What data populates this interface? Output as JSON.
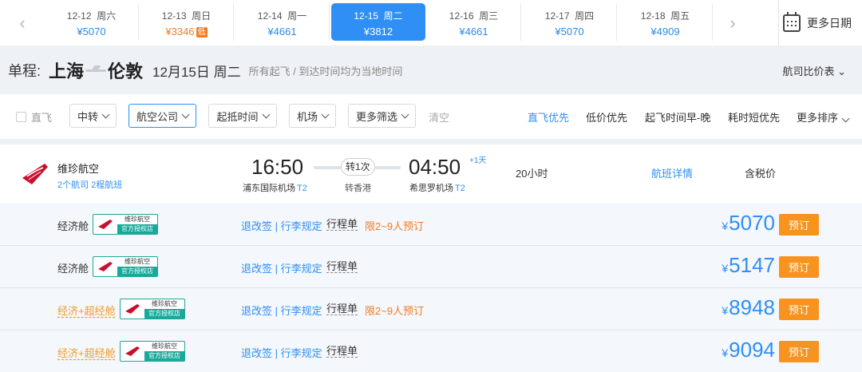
{
  "date_bar": {
    "dates": [
      {
        "date": "12-12",
        "weekday": "周六",
        "price": "¥5070"
      },
      {
        "date": "12-13",
        "weekday": "周日",
        "price": "¥3346",
        "badge": "低"
      },
      {
        "date": "12-14",
        "weekday": "周一",
        "price": "¥4661"
      },
      {
        "date": "12-15",
        "weekday": "周二",
        "price": "¥3812"
      },
      {
        "date": "12-16",
        "weekday": "周三",
        "price": "¥4661"
      },
      {
        "date": "12-17",
        "weekday": "周四",
        "price": "¥5070"
      },
      {
        "date": "12-18",
        "weekday": "周五",
        "price": "¥4909"
      }
    ],
    "prev_icon": "‹",
    "next_icon": "›",
    "more_label": "更多日期"
  },
  "route": {
    "trip_label": "单程:",
    "from": "上海",
    "to": "伦敦",
    "date": "12月15日 周二",
    "note": "所有起飞 / 到达时间均为当地时间",
    "compare_label": "航司比价表",
    "compare_icon": "⌄"
  },
  "filters": {
    "direct_label": "直飞",
    "buttons": [
      "中转",
      "航空公司",
      "起抵时间",
      "机场",
      "更多筛选"
    ],
    "clear_label": "清空",
    "sorts": [
      "直飞优先",
      "低价优先",
      "起飞时间早-晚",
      "耗时短优先",
      "更多排序"
    ]
  },
  "flight": {
    "airline": "维珍航空",
    "airline_sub": "2个航司  2程航班",
    "dep_time": "16:50",
    "arr_time": "04:50",
    "plus_day": "+1天",
    "dep_airport": "浦东国际机场",
    "dep_terminal": "T2",
    "arr_airport": "希思罗机场",
    "arr_terminal": "T2",
    "transfer": "转1次",
    "via": "转香港",
    "duration": "20小时",
    "detail_label": "航班详情",
    "tax_note": "含税价",
    "brand_color": "#c8102e"
  },
  "badge_text": {
    "line1": "维珍航空",
    "line2": "官方授权店"
  },
  "fares": [
    {
      "cabin": "经济舱",
      "links": "退改签 | 行李规定",
      "itinerary": "行程单",
      "limit": "限2~9人预订",
      "currency": "¥",
      "price": "5070",
      "book": "预订"
    },
    {
      "cabin": "经济舱",
      "links": "退改签 | 行李规定",
      "itinerary": "行程单",
      "limit": "",
      "currency": "¥",
      "price": "5147",
      "book": "预订"
    },
    {
      "cabin": "经济+超经舱",
      "links": "退改签 | 行李规定",
      "itinerary": "行程单",
      "limit": "限2~9人预订",
      "currency": "¥",
      "price": "8948",
      "book": "预订"
    },
    {
      "cabin": "经济+超经舱",
      "links": "退改签 | 行李规定",
      "itinerary": "行程单",
      "limit": "",
      "currency": "¥",
      "price": "9094",
      "book": "预订"
    }
  ]
}
